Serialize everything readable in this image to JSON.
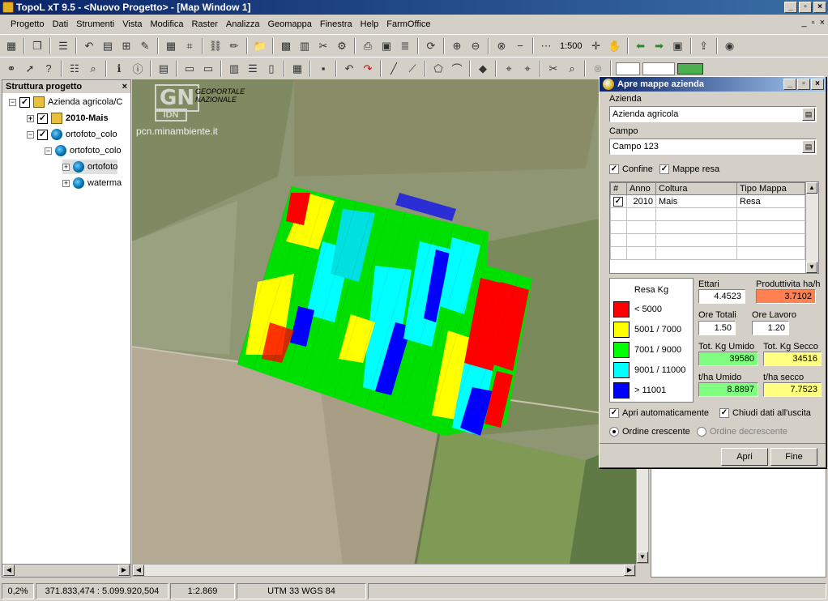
{
  "window": {
    "title": "TopoL xT 9.5 - <Nuovo Progetto> - [Map Window 1]",
    "minimize": "_",
    "maximize": "▫",
    "close": "×"
  },
  "menu": [
    "Progetto",
    "Dati",
    "Strumenti",
    "Vista",
    "Modifica",
    "Raster",
    "Analizza",
    "Geomappa",
    "Finestra",
    "Help",
    "FarmOffice"
  ],
  "toolbar": {
    "scale_value": "1:500"
  },
  "sidebar": {
    "title": "Struttura progetto",
    "close": "×",
    "tree": [
      {
        "label": "Azienda agricola/C",
        "expander": "−"
      },
      {
        "label": "2010-Mais",
        "expander": "+"
      },
      {
        "label": "ortofoto_colo",
        "expander": "−"
      },
      {
        "label": "ortofoto_colo",
        "expander": "−"
      },
      {
        "label": "ortofoto",
        "expander": "+"
      },
      {
        "label": "waterma",
        "expander": "+"
      }
    ]
  },
  "map": {
    "watermark_logo": "GN",
    "watermark_sub": "IDN",
    "watermark_name": "GEOPORTALE NAZIONALE",
    "watermark_url": "pcn.minambiente.it"
  },
  "dialog": {
    "title": "Apre mappe azienda",
    "azienda_label": "Azienda",
    "azienda_value": "Azienda agricola",
    "campo_label": "Campo",
    "campo_value": "Campo 123",
    "confine_label": "Confine",
    "mappe_resa_label": "Mappe resa",
    "table": {
      "headers": [
        "#",
        "Anno",
        "Coltura",
        "Tipo Mappa"
      ],
      "rows": [
        {
          "check": "✓",
          "anno": "2010",
          "coltura": "Mais",
          "tipo": "Resa"
        }
      ]
    },
    "legend": {
      "title": "Resa Kg",
      "items": [
        {
          "label": "< 5000",
          "color": "#ff0000"
        },
        {
          "label": "5001 / 7000",
          "color": "#ffff00"
        },
        {
          "label": "7001 / 9000",
          "color": "#00ff00"
        },
        {
          "label": "9001 / 11000",
          "color": "#00ffff"
        },
        {
          "label": "> 11001",
          "color": "#0000ff"
        }
      ]
    },
    "stats": {
      "ettari_label": "Ettari",
      "ettari": "4.4523",
      "produttivita_label": "Produttivita ha/h",
      "produttivita": "3.7102",
      "ore_totali_label": "Ore Totali",
      "ore_totali": "1.50",
      "ore_lavoro_label": "Ore Lavoro",
      "ore_lavoro": "1.20",
      "tot_umido_label": "Tot. Kg Umido",
      "tot_umido": "39580",
      "tot_secco_label": "Tot. Kg Secco",
      "tot_secco": "34516",
      "tha_umido_label": "t/ha Umido",
      "tha_umido": "8.8897",
      "tha_secco_label": "t/ha secco",
      "tha_secco": "7.7523"
    },
    "apri_auto_label": "Apri automaticamente",
    "chiudi_label": "Chiudi dati all'uscita",
    "ordine_cresc": "Ordine crescente",
    "ordine_decresc": "Ordine decrescente",
    "apri_btn": "Apri",
    "fine_btn": "Fine"
  },
  "status": {
    "zoom": "0,2%",
    "coords": "371.833,474 : 5.099.920,504",
    "scale": "1:2.869",
    "crs": "UTM 33 WGS 84"
  },
  "colors": {
    "produttivita_bg": "#ff8050",
    "green_bg": "#80ff80",
    "yellow_bg": "#ffff80"
  }
}
